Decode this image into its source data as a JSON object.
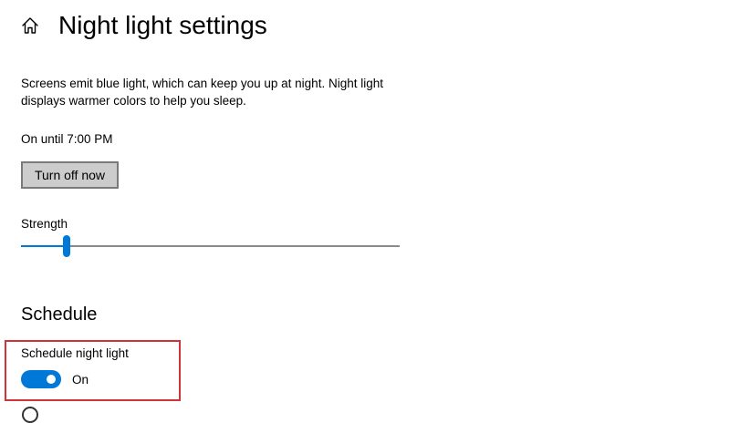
{
  "header": {
    "home_icon": "home-icon",
    "title": "Night light settings"
  },
  "intro": {
    "description": "Screens emit blue light, which can keep you up at night. Night light displays warmer colors to help you sleep.",
    "status": "On until 7:00 PM",
    "turn_off_label": "Turn off now"
  },
  "strength": {
    "label": "Strength",
    "value_fraction": 0.12
  },
  "schedule": {
    "heading": "Schedule",
    "toggle_label": "Schedule night light",
    "toggle_state": "On",
    "toggle_on": true
  },
  "colors": {
    "accent": "#0078d7",
    "highlight": "#d13438",
    "button_bg": "#cccccc"
  }
}
